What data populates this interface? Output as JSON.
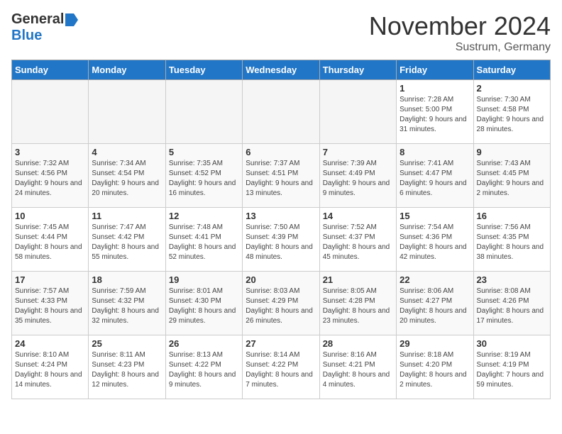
{
  "header": {
    "logo": {
      "general": "General",
      "blue": "Blue"
    },
    "title": "November 2024",
    "location": "Sustrum, Germany"
  },
  "weekdays": [
    "Sunday",
    "Monday",
    "Tuesday",
    "Wednesday",
    "Thursday",
    "Friday",
    "Saturday"
  ],
  "weeks": [
    [
      {
        "day": "",
        "info": ""
      },
      {
        "day": "",
        "info": ""
      },
      {
        "day": "",
        "info": ""
      },
      {
        "day": "",
        "info": ""
      },
      {
        "day": "",
        "info": ""
      },
      {
        "day": "1",
        "info": "Sunrise: 7:28 AM\nSunset: 5:00 PM\nDaylight: 9 hours\nand 31 minutes."
      },
      {
        "day": "2",
        "info": "Sunrise: 7:30 AM\nSunset: 4:58 PM\nDaylight: 9 hours\nand 28 minutes."
      }
    ],
    [
      {
        "day": "3",
        "info": "Sunrise: 7:32 AM\nSunset: 4:56 PM\nDaylight: 9 hours\nand 24 minutes."
      },
      {
        "day": "4",
        "info": "Sunrise: 7:34 AM\nSunset: 4:54 PM\nDaylight: 9 hours\nand 20 minutes."
      },
      {
        "day": "5",
        "info": "Sunrise: 7:35 AM\nSunset: 4:52 PM\nDaylight: 9 hours\nand 16 minutes."
      },
      {
        "day": "6",
        "info": "Sunrise: 7:37 AM\nSunset: 4:51 PM\nDaylight: 9 hours\nand 13 minutes."
      },
      {
        "day": "7",
        "info": "Sunrise: 7:39 AM\nSunset: 4:49 PM\nDaylight: 9 hours\nand 9 minutes."
      },
      {
        "day": "8",
        "info": "Sunrise: 7:41 AM\nSunset: 4:47 PM\nDaylight: 9 hours\nand 6 minutes."
      },
      {
        "day": "9",
        "info": "Sunrise: 7:43 AM\nSunset: 4:45 PM\nDaylight: 9 hours\nand 2 minutes."
      }
    ],
    [
      {
        "day": "10",
        "info": "Sunrise: 7:45 AM\nSunset: 4:44 PM\nDaylight: 8 hours\nand 58 minutes."
      },
      {
        "day": "11",
        "info": "Sunrise: 7:47 AM\nSunset: 4:42 PM\nDaylight: 8 hours\nand 55 minutes."
      },
      {
        "day": "12",
        "info": "Sunrise: 7:48 AM\nSunset: 4:41 PM\nDaylight: 8 hours\nand 52 minutes."
      },
      {
        "day": "13",
        "info": "Sunrise: 7:50 AM\nSunset: 4:39 PM\nDaylight: 8 hours\nand 48 minutes."
      },
      {
        "day": "14",
        "info": "Sunrise: 7:52 AM\nSunset: 4:37 PM\nDaylight: 8 hours\nand 45 minutes."
      },
      {
        "day": "15",
        "info": "Sunrise: 7:54 AM\nSunset: 4:36 PM\nDaylight: 8 hours\nand 42 minutes."
      },
      {
        "day": "16",
        "info": "Sunrise: 7:56 AM\nSunset: 4:35 PM\nDaylight: 8 hours\nand 38 minutes."
      }
    ],
    [
      {
        "day": "17",
        "info": "Sunrise: 7:57 AM\nSunset: 4:33 PM\nDaylight: 8 hours\nand 35 minutes."
      },
      {
        "day": "18",
        "info": "Sunrise: 7:59 AM\nSunset: 4:32 PM\nDaylight: 8 hours\nand 32 minutes."
      },
      {
        "day": "19",
        "info": "Sunrise: 8:01 AM\nSunset: 4:30 PM\nDaylight: 8 hours\nand 29 minutes."
      },
      {
        "day": "20",
        "info": "Sunrise: 8:03 AM\nSunset: 4:29 PM\nDaylight: 8 hours\nand 26 minutes."
      },
      {
        "day": "21",
        "info": "Sunrise: 8:05 AM\nSunset: 4:28 PM\nDaylight: 8 hours\nand 23 minutes."
      },
      {
        "day": "22",
        "info": "Sunrise: 8:06 AM\nSunset: 4:27 PM\nDaylight: 8 hours\nand 20 minutes."
      },
      {
        "day": "23",
        "info": "Sunrise: 8:08 AM\nSunset: 4:26 PM\nDaylight: 8 hours\nand 17 minutes."
      }
    ],
    [
      {
        "day": "24",
        "info": "Sunrise: 8:10 AM\nSunset: 4:24 PM\nDaylight: 8 hours\nand 14 minutes."
      },
      {
        "day": "25",
        "info": "Sunrise: 8:11 AM\nSunset: 4:23 PM\nDaylight: 8 hours\nand 12 minutes."
      },
      {
        "day": "26",
        "info": "Sunrise: 8:13 AM\nSunset: 4:22 PM\nDaylight: 8 hours\nand 9 minutes."
      },
      {
        "day": "27",
        "info": "Sunrise: 8:14 AM\nSunset: 4:22 PM\nDaylight: 8 hours\nand 7 minutes."
      },
      {
        "day": "28",
        "info": "Sunrise: 8:16 AM\nSunset: 4:21 PM\nDaylight: 8 hours\nand 4 minutes."
      },
      {
        "day": "29",
        "info": "Sunrise: 8:18 AM\nSunset: 4:20 PM\nDaylight: 8 hours\nand 2 minutes."
      },
      {
        "day": "30",
        "info": "Sunrise: 8:19 AM\nSunset: 4:19 PM\nDaylight: 7 hours\nand 59 minutes."
      }
    ]
  ]
}
